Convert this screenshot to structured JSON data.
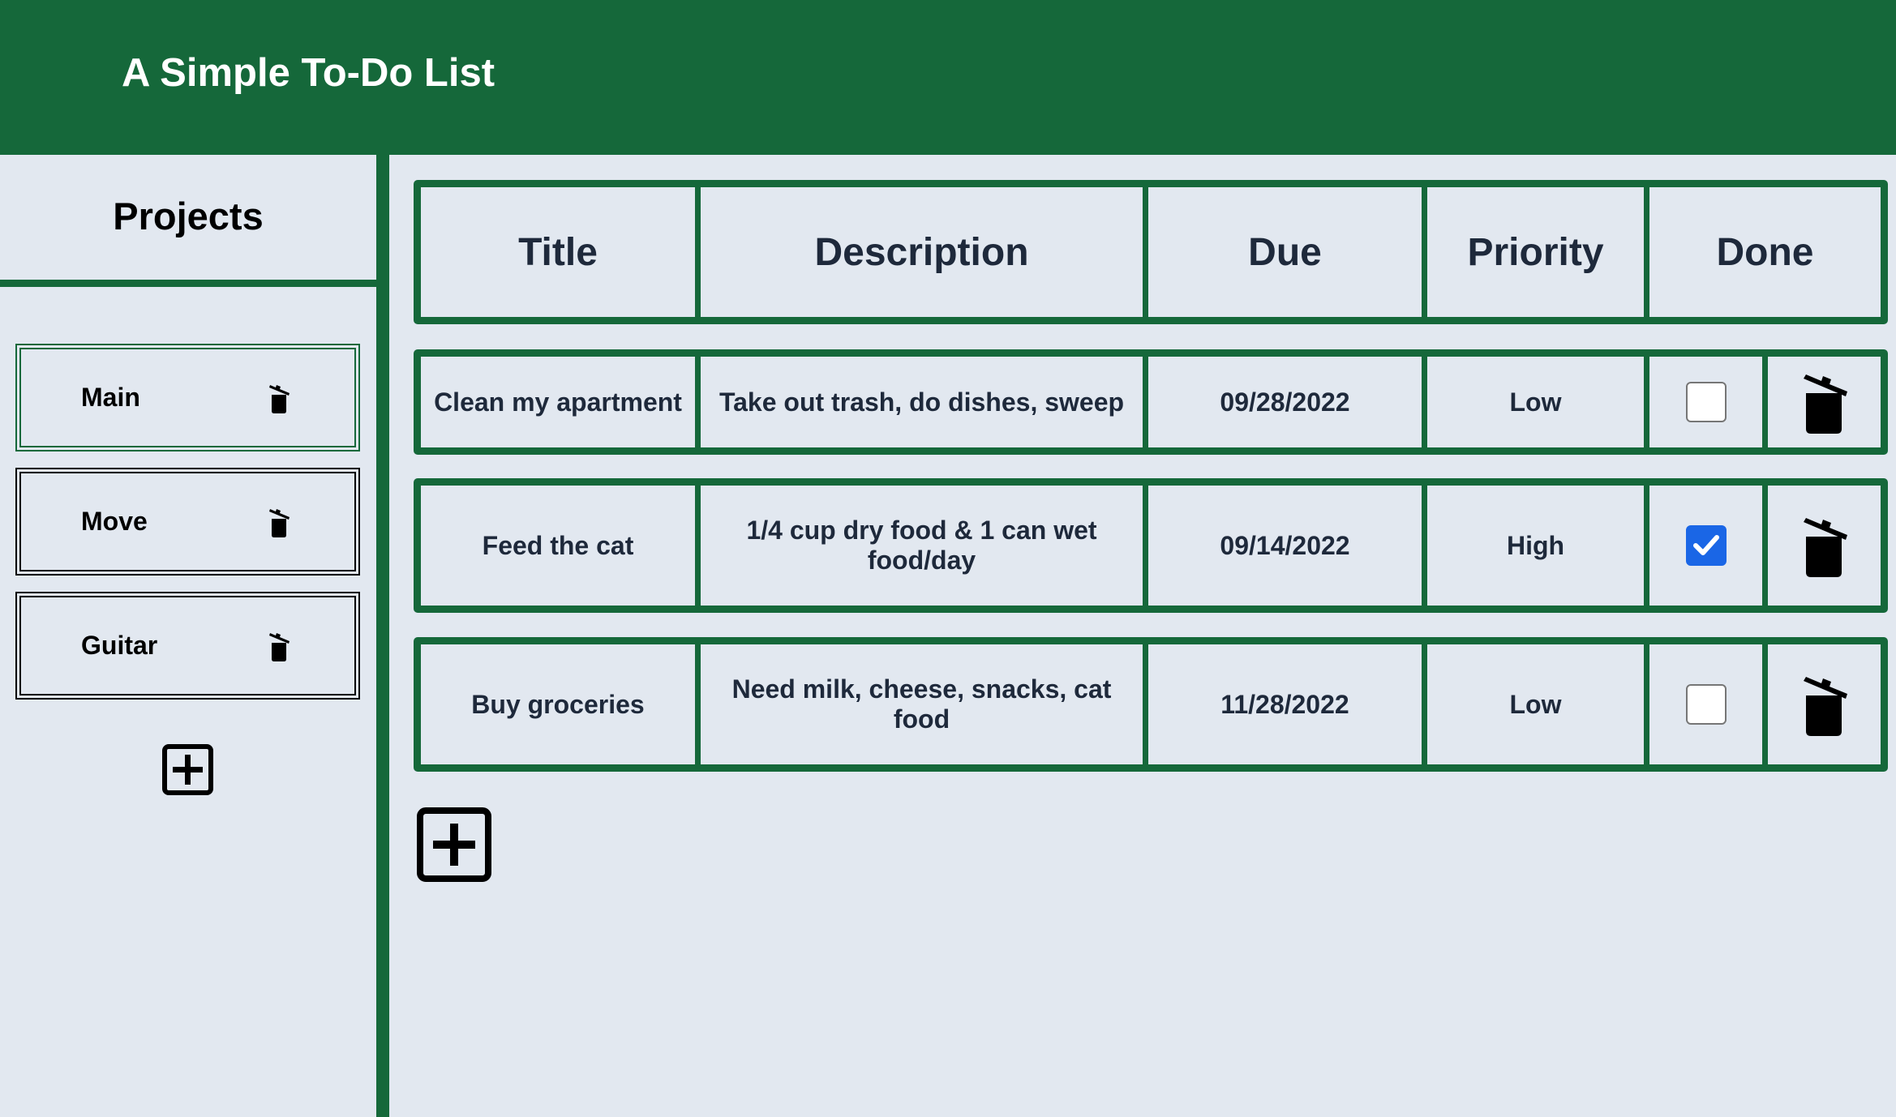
{
  "header": {
    "title": "A Simple To-Do List"
  },
  "sidebar": {
    "heading": "Projects",
    "projects": [
      {
        "label": "Main",
        "active": true
      },
      {
        "label": "Move",
        "active": false
      },
      {
        "label": "Guitar",
        "active": false
      }
    ],
    "add_icon": "plus-square-icon"
  },
  "table": {
    "headers": [
      "Title",
      "Description",
      "Due",
      "Priority",
      "Done"
    ],
    "rows": [
      {
        "title": "Clean my apartment",
        "description": "Take out trash, do dishes, sweep",
        "due": "09/28/2022",
        "priority": "Low",
        "done": false
      },
      {
        "title": "Feed the cat",
        "description": "1/4 cup dry food & 1 can wet food/day",
        "due": "09/14/2022",
        "priority": "High",
        "done": true
      },
      {
        "title": "Buy groceries",
        "description": "Need milk, cheese, snacks, cat food",
        "due": "11/28/2022",
        "priority": "Low",
        "done": false
      }
    ],
    "add_icon": "plus-square-icon",
    "delete_icon": "trash-icon"
  },
  "colors": {
    "brand_green": "#15683a",
    "background": "#e2e8f0",
    "checkbox_checked": "#1a66e6"
  }
}
